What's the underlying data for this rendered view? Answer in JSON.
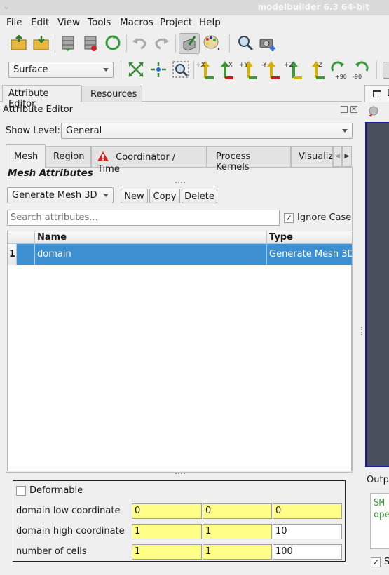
{
  "window": {
    "title": "modelbuilder 6.3 64-bit"
  },
  "menu": [
    "File",
    "Edit",
    "View",
    "Tools",
    "Macros",
    "Project",
    "Help"
  ],
  "toolbar": {
    "representation": "Surface",
    "rotate_pos90": "+90",
    "rotate_neg90": "-90",
    "axis_labels": [
      "+X",
      "-X",
      "+Y",
      "-Y",
      "+Z",
      "-Z"
    ]
  },
  "dock_tabs": [
    "Attribute Editor",
    "Resources"
  ],
  "panel": {
    "title": "Attribute Editor",
    "show_level_label": "Show Level:",
    "show_level_value": "General"
  },
  "def_tabs": [
    "Mesh",
    "Region",
    "Coordinator / Time",
    "Process Kernels",
    "Visualiz"
  ],
  "section_title": "Mesh Attributes",
  "attr_type": "Generate Mesh 3D",
  "buttons": {
    "new": "New",
    "copy": "Copy",
    "delete": "Delete"
  },
  "search": {
    "placeholder": "Search attributes...",
    "ignore_case": "Ignore Case"
  },
  "table": {
    "headers": [
      "Name",
      "Type"
    ],
    "rows": [
      {
        "index": "1",
        "name": "domain",
        "type": "Generate Mesh 3D"
      }
    ]
  },
  "props": {
    "deformable": "Deformable",
    "low_label": "domain low coordinate",
    "low": [
      "0",
      "0",
      "0"
    ],
    "high_label": "domain high coordinate",
    "high": [
      "1",
      "1",
      "10"
    ],
    "cells_label": "number of cells",
    "cells": [
      "1",
      "1",
      "100"
    ]
  },
  "right": {
    "tab_label": "L",
    "output_label": "Outpu",
    "console_1": "SM",
    "console_2": "ope",
    "check_label": "S"
  },
  "colors": {
    "selection": "#3c8fd0",
    "required_field": "#ffff88",
    "view_bg": "#4a4f5e",
    "view_border": "#1a1aa0"
  }
}
